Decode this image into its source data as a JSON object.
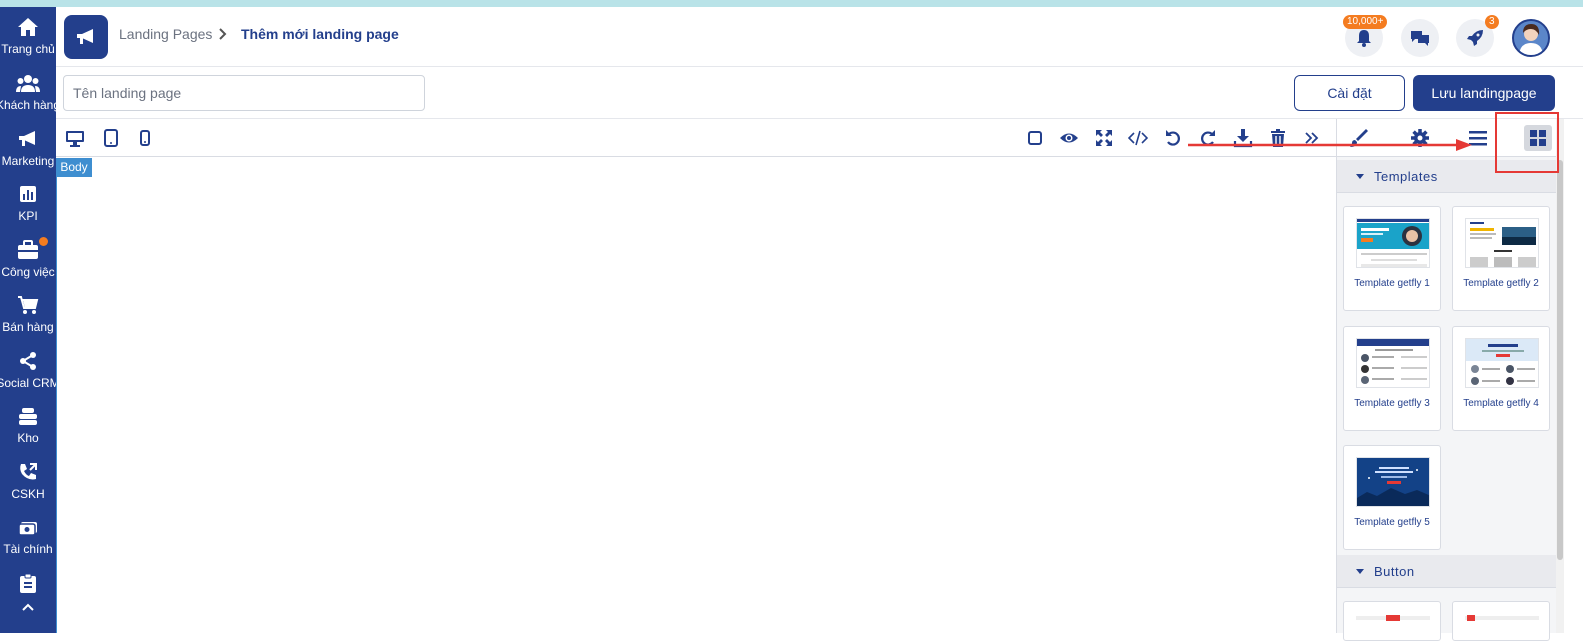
{
  "sidebar": {
    "items": [
      {
        "label": "Trang chủ",
        "icon": "home-icon"
      },
      {
        "label": "Khách hàng",
        "icon": "users-icon"
      },
      {
        "label": "Marketing",
        "icon": "megaphone-icon"
      },
      {
        "label": "KPI",
        "icon": "bar-chart-icon"
      },
      {
        "label": "Công việc",
        "icon": "briefcase-icon"
      },
      {
        "label": "Bán hàng",
        "icon": "cart-icon"
      },
      {
        "label": "Social CRM",
        "icon": "share-icon"
      },
      {
        "label": "Kho",
        "icon": "warehouse-icon"
      },
      {
        "label": "CSKH",
        "icon": "phone-icon"
      },
      {
        "label": "Tài chính",
        "icon": "money-icon"
      },
      {
        "label": "",
        "icon": "clipboard-icon"
      }
    ]
  },
  "header": {
    "breadcrumb_parent": "Landing Pages",
    "breadcrumb_current": "Thêm mới landing page",
    "notifications_badge": "10,000+",
    "rocket_badge": "3"
  },
  "form": {
    "name_placeholder": "Tên landing page",
    "name_value": "",
    "settings_label": "Cài đặt",
    "save_label": "Lưu landingpage"
  },
  "editor": {
    "body_tag": "Body",
    "device_icons": [
      "desktop-icon",
      "tablet-icon",
      "mobile-icon"
    ],
    "tool_icons": [
      "square-outline-icon",
      "eye-icon",
      "fullscreen-icon",
      "code-icon",
      "undo-icon",
      "redo-icon",
      "download-icon",
      "trash-icon",
      "double-chevron-right-icon"
    ]
  },
  "panel": {
    "tabs": [
      "brush-icon",
      "gear-icon",
      "layers-icon",
      "blocks-icon"
    ],
    "sections": [
      {
        "title": "Templates"
      },
      {
        "title": "Button"
      }
    ],
    "templates": [
      {
        "name": "Template getfly 1"
      },
      {
        "name": "Template getfly 2"
      },
      {
        "name": "Template getfly 3"
      },
      {
        "name": "Template getfly 4"
      },
      {
        "name": "Template getfly 5"
      }
    ]
  },
  "colors": {
    "brand": "#233f8c",
    "accent_orange": "#f47c20",
    "selection_blue": "#3e8ed0",
    "annotation_red": "#e53935"
  }
}
